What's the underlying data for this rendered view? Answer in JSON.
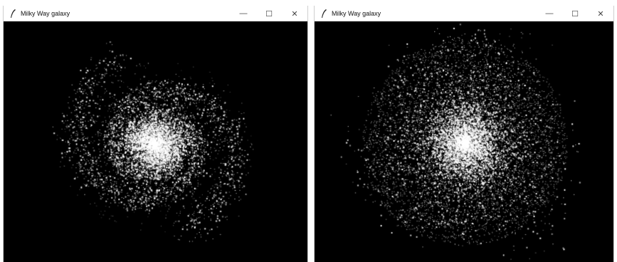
{
  "windows": [
    {
      "title": "Milky Way galaxy",
      "app_icon": "feather-icon",
      "controls": {
        "minimize": "—",
        "maximize": "☐",
        "close": "✕"
      },
      "galaxy": {
        "style": "spiral-arms",
        "background": "#000000",
        "star_color": "#ffffff"
      }
    },
    {
      "title": "Milky Way galaxy",
      "app_icon": "feather-icon",
      "controls": {
        "minimize": "—",
        "maximize": "☐",
        "close": "✕"
      },
      "galaxy": {
        "style": "diffuse-disc",
        "background": "#000000",
        "star_color": "#ffffff"
      }
    }
  ]
}
